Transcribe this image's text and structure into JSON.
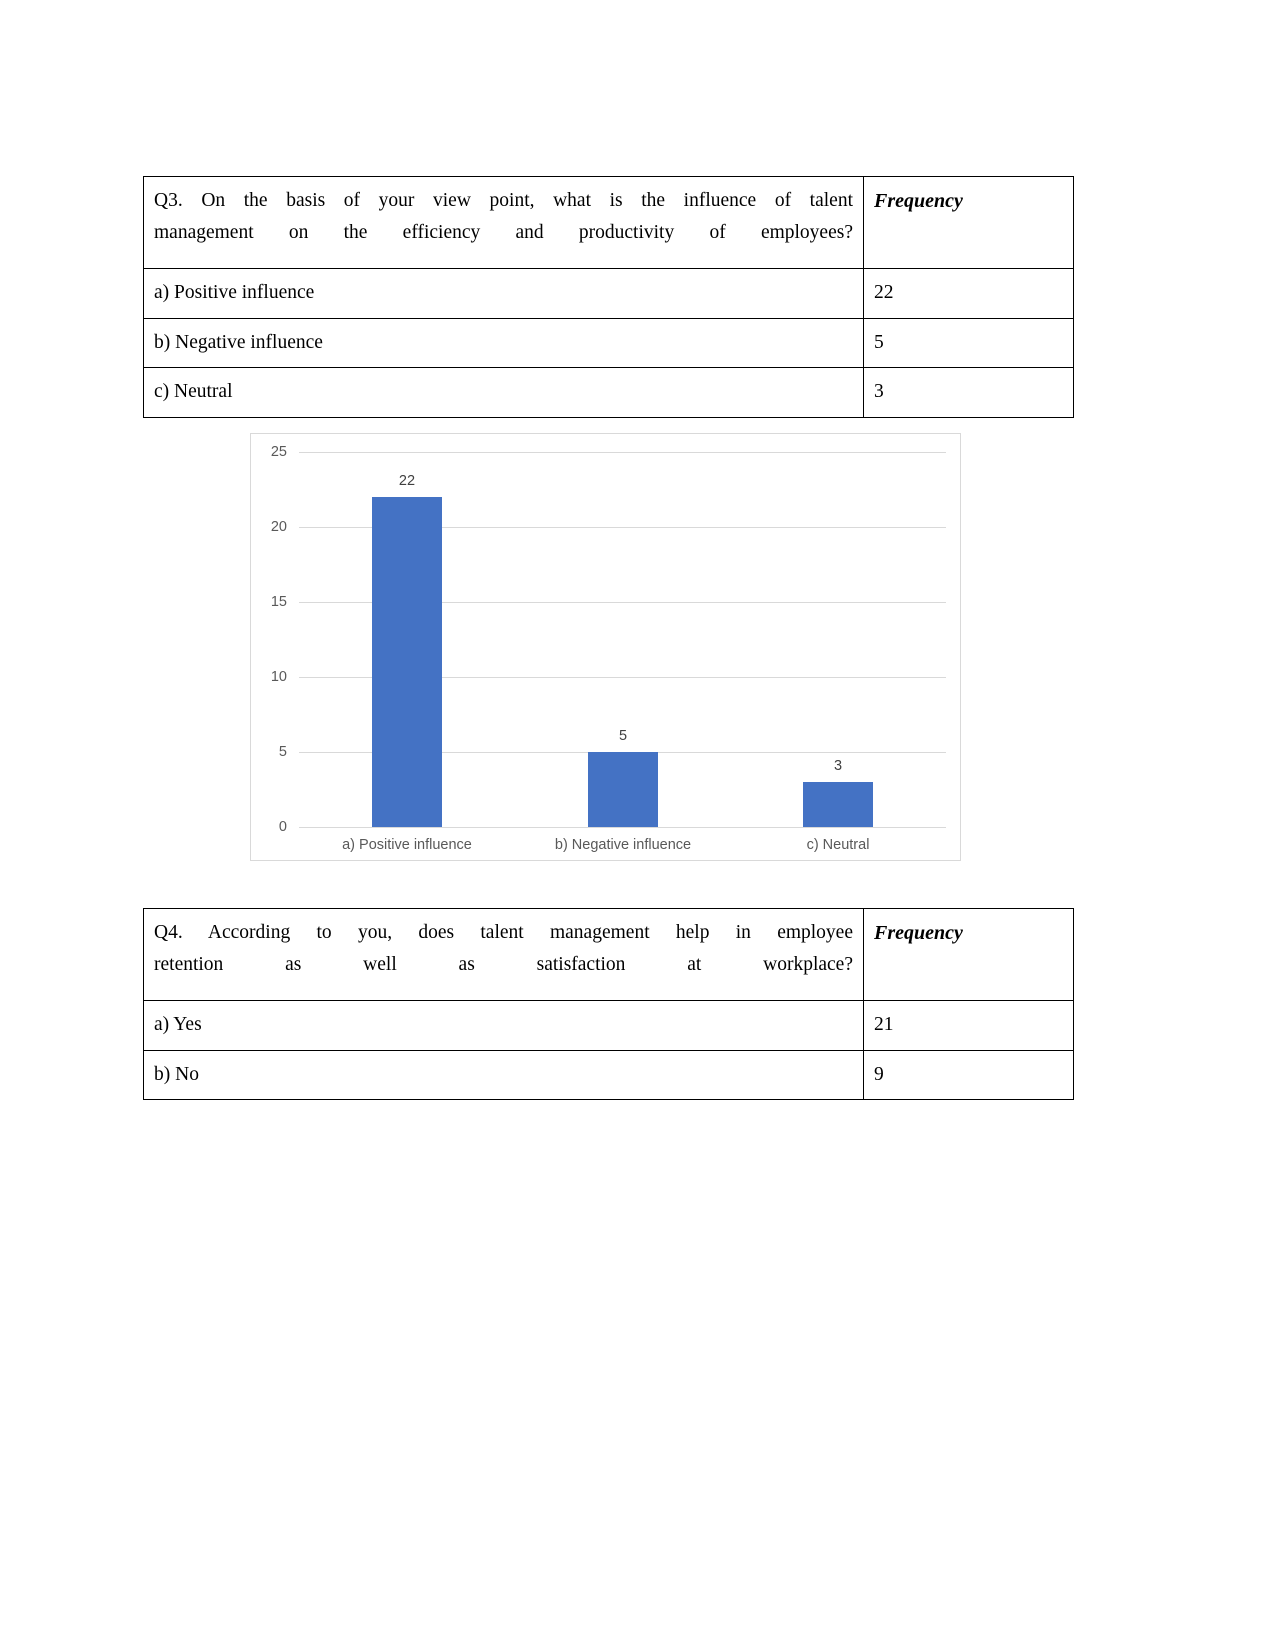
{
  "document": {
    "tables": [
      {
        "id": "q3-table",
        "question": "Q3. On the basis of your view point, what is the influence of talent management on the efficiency and productivity of employees?",
        "question_line1": "Q3. On the basis of your view point, what is the influence of talent",
        "question_line2": "management on the efficiency and productivity of employees?",
        "frequency_header": "Frequency",
        "rows": [
          {
            "option": "a) Positive influence",
            "frequency": "22"
          },
          {
            "option": "b) Negative influence",
            "frequency": "5"
          },
          {
            "option": "c) Neutral",
            "frequency": "3"
          }
        ]
      },
      {
        "id": "q4-table",
        "question": "Q4. According to you, does talent management help in employee retention as well as satisfaction at workplace?",
        "question_line1": "Q4. According to you, does talent management help in employee",
        "question_line2": "retention as well as satisfaction at workplace?",
        "frequency_header": "Frequency",
        "rows": [
          {
            "option": "a) Yes",
            "frequency": "21"
          },
          {
            "option": "b) No",
            "frequency": "9"
          }
        ]
      }
    ]
  },
  "chart_data": {
    "type": "bar",
    "title": "",
    "subtitle": "",
    "xlabel": "",
    "ylabel": "",
    "categories": [
      "a) Positive influence",
      "b) Negative influence",
      "c) Neutral"
    ],
    "values": [
      22,
      5,
      3
    ],
    "data_labels": [
      "22",
      "5",
      "3"
    ],
    "ylim": [
      0,
      25
    ],
    "yticks": [
      0,
      5,
      10,
      15,
      20,
      25
    ],
    "ytick_labels": [
      "0",
      "5",
      "10",
      "15",
      "20",
      "25"
    ],
    "grid": true,
    "grid_axis": "y",
    "legend": false,
    "legend_position": "none",
    "series": [
      {
        "name": "Frequency",
        "values": [
          22,
          5,
          3
        ],
        "color": "#4472C4"
      }
    ],
    "colors": {
      "bar": "#4472C4",
      "gridline": "#D9D9D9",
      "border": "#D9D9D9",
      "tick_text": "#595959",
      "label_text": "#404040",
      "background": "#FFFFFF"
    }
  }
}
